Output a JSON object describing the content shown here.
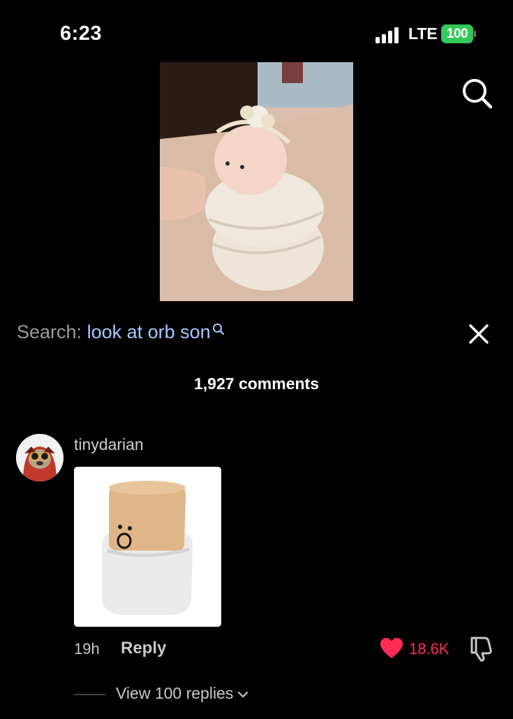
{
  "status_bar": {
    "time": "6:23",
    "network": "LTE",
    "battery": "100",
    "battery_color": "#34c759"
  },
  "header": {
    "search_icon": "search-icon"
  },
  "search": {
    "prefix": "Search:",
    "query": "look at orb son",
    "query_icon": "search-icon",
    "close_icon": "close-icon",
    "query_color": "#a8c8ff"
  },
  "comments_header": {
    "count_label": "1,927 comments"
  },
  "comment": {
    "username": "tinydarian",
    "age": "19h",
    "reply_label": "Reply",
    "likes": "18.6K",
    "like_color": "#fe2c55",
    "view_replies": "View 100 replies",
    "dislike_icon": "thumbs-down-icon",
    "heart_icon": "heart-icon"
  }
}
